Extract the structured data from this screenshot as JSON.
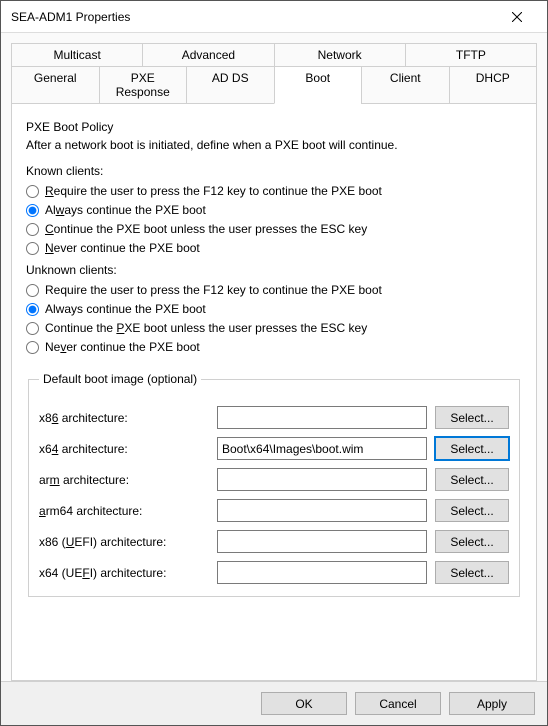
{
  "window": {
    "title": "SEA-ADM1 Properties"
  },
  "tabs": {
    "row1": [
      "Multicast",
      "Advanced",
      "Network",
      "TFTP"
    ],
    "row2": [
      "General",
      "PXE Response",
      "AD DS",
      "Boot",
      "Client",
      "DHCP"
    ],
    "active": "Boot"
  },
  "policy": {
    "title": "PXE Boot Policy",
    "desc": "After a network boot is initiated, define when a PXE boot will continue.",
    "known_header": "Known clients:",
    "unknown_header": "Unknown clients:",
    "opt_require_pre": "R",
    "opt_require_post": "equire the user to press the F12 key to continue the PXE boot",
    "opt_always_pre": "Al",
    "opt_always_u": "w",
    "opt_always_post": "ays continue the PXE boot",
    "opt_esc_pre": "C",
    "opt_esc_post": "ontinue the PXE boot unless the user presses the ESC key",
    "opt_never_pre": "N",
    "opt_never_post": "ever continue the PXE boot",
    "u_opt_require": "Require the user to press the F12 key to continue the PXE boot",
    "u_opt_always": "Always continue the PXE boot",
    "u_opt_esc_pre": "Continue the ",
    "u_opt_esc_u": "P",
    "u_opt_esc_post": "XE boot unless the user presses the ESC key",
    "u_opt_never_pre": "Ne",
    "u_opt_never_u": "v",
    "u_opt_never_post": "er continue the PXE boot",
    "known_selected": "always",
    "unknown_selected": "always"
  },
  "boot_images": {
    "legend": "Default boot image (optional)",
    "select_label": "Select...",
    "rows": [
      {
        "label_pre": "x8",
        "label_u": "6",
        "label_post": " architecture:",
        "value": ""
      },
      {
        "label_pre": "x6",
        "label_u": "4",
        "label_post": " architecture:",
        "value": "Boot\\x64\\Images\\boot.wim"
      },
      {
        "label_pre": "ar",
        "label_u": "m",
        "label_post": " architecture:",
        "value": ""
      },
      {
        "label_pre": "",
        "label_u": "a",
        "label_post": "rm64 architecture:",
        "value": ""
      },
      {
        "label_pre": "x86 (",
        "label_u": "U",
        "label_post": "EFI) architecture:",
        "value": ""
      },
      {
        "label_pre": "x64 (UE",
        "label_u": "F",
        "label_post": "I) architecture:",
        "value": ""
      }
    ],
    "focused_row": 1
  },
  "buttons": {
    "ok": "OK",
    "cancel": "Cancel",
    "apply": "Apply"
  }
}
